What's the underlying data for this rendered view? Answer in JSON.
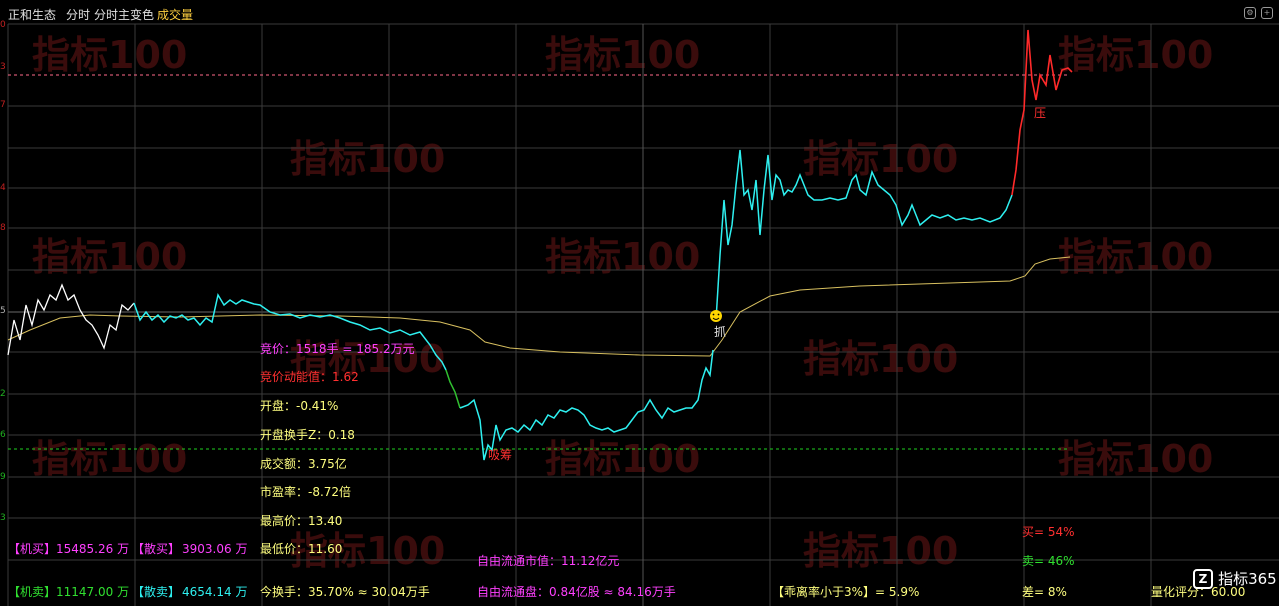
{
  "header": {
    "stock_name": "正和生态",
    "mode1": "分时",
    "mode2": "分时主变色",
    "indicator": "成交量"
  },
  "watermark": "指标100",
  "colors": {
    "up": "#ff2a2a",
    "down": "#2ef0f0",
    "avg": "#d8c060",
    "neutral": "#ffffff",
    "magenta": "#ff40ff",
    "yellow": "#ffff80"
  },
  "markers": {
    "grab": "抓",
    "pressure": "压",
    "chips": "吸筹",
    "smiley_icon": "smiley-icon"
  },
  "stats": {
    "auction_price": "竞价：1518手 = 185.2万元",
    "auction_momentum": "竞价动能值：1.62",
    "open": "开盘：-0.41%",
    "open_turnover": "开盘换手Z：0.18",
    "volume_amount": "成交额：3.75亿",
    "pe": "市盈率：-8.72倍",
    "high": "最高价：13.40",
    "low": "最低价：11.60",
    "float_cap": "自由流通市值：11.12亿元",
    "float_shares": "自由流通盘：0.84亿股 ≈ 84.16万手",
    "turnover": "今换手：35.70% ≈ 30.04万手",
    "deviation": "【乖离率小于3%】= 5.9%",
    "buy_pct": "买= 54%",
    "sell_pct": "卖= 46%",
    "diff_pct": "差= 8%",
    "score": "量化评分：60.00"
  },
  "flows": {
    "inst_buy_label": "【机买】",
    "inst_buy_value": "15485.26 万",
    "retail_buy_label": "【散买】",
    "retail_buy_value": "3903.06 万",
    "inst_sell_label": "【机卖】",
    "inst_sell_value": "11147.00 万",
    "retail_sell_label": "【散卖】",
    "retail_sell_value": "4654.14 万"
  },
  "logo": "指标365"
}
